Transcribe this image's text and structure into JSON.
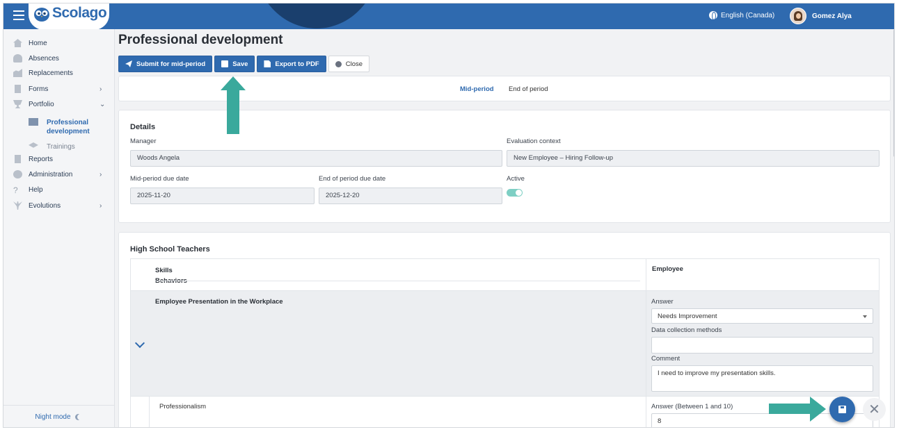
{
  "app": {
    "brand": "Scolago"
  },
  "header": {
    "language": "English (Canada)",
    "user_name": "Gomez Alya"
  },
  "sidebar": {
    "items": [
      {
        "label": "Home"
      },
      {
        "label": "Absences"
      },
      {
        "label": "Replacements"
      },
      {
        "label": "Forms",
        "chevron": "›"
      },
      {
        "label": "Portfolio",
        "chevron": "⌄"
      },
      {
        "label": "Reports"
      },
      {
        "label": "Administration",
        "chevron": "›"
      },
      {
        "label": "Help"
      },
      {
        "label": "Evolutions",
        "chevron": "›"
      }
    ],
    "portfolio_sub": [
      {
        "label": "Professional development"
      },
      {
        "label": "Trainings"
      }
    ],
    "night_mode": "Night mode"
  },
  "page": {
    "title": "Professional development",
    "actions": {
      "submit": "Submit for mid-period",
      "save": "Save",
      "export": "Export to PDF",
      "close": "Close"
    },
    "tabs": [
      "Mid-period",
      "End of period"
    ],
    "details": {
      "heading": "Details",
      "manager_label": "Manager",
      "manager_value": "Woods Angela",
      "context_label": "Evaluation context",
      "context_value": "New Employee – Hiring Follow-up",
      "mid_due_label": "Mid-period due date",
      "mid_due_value": "2025-11-20",
      "end_due_label": "End of period due date",
      "end_due_value": "2025-12-20",
      "active_label": "Active",
      "active": true
    },
    "section": {
      "heading": "High School Teachers",
      "col_skills": "Skills",
      "col_behaviors": "Behaviors",
      "col_employee": "Employee",
      "row1": {
        "title": "Employee Presentation in the Workplace",
        "answer_label": "Answer",
        "answer_value": "Needs Improvement",
        "methods_label": "Data collection methods",
        "methods_value": "",
        "comment_label": "Comment",
        "comment_value": "I need to improve my presentation skills."
      },
      "row2": {
        "title": "Professionalism",
        "answer_label": "Answer (Between 1 and 10)",
        "answer_value": "8"
      }
    }
  },
  "colors": {
    "primary": "#2f6aaf",
    "accent_arrow": "#3aa99c"
  }
}
